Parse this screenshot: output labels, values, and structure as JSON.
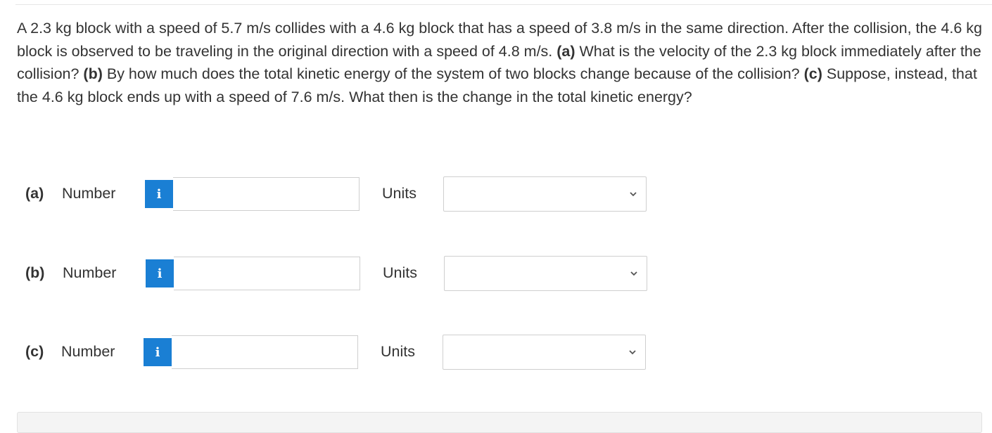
{
  "question": {
    "p1": "A 2.3 kg block with a speed of 5.7 m/s collides with a 4.6 kg block that has a speed of 3.8 m/s in the same direction. After the collision, the 4.6 kg block is observed to be traveling in the original direction with a speed of 4.8 m/s. ",
    "a_tag": "(a)",
    "p2": " What is the velocity of the 2.3 kg block immediately after the collision? ",
    "b_tag": "(b)",
    "p3": " By how much does the total kinetic energy of the system of two blocks change because of the collision? ",
    "c_tag": "(c)",
    "p4": " Suppose, instead, that the 4.6 kg block ends up with a speed of 7.6 m/s. What then is the change in the total kinetic energy?"
  },
  "parts": [
    {
      "tag": "(a)",
      "number_label": "Number",
      "info_icon": "i",
      "value": "",
      "units_label": "Units",
      "units_value": ""
    },
    {
      "tag": "(b)",
      "number_label": "Number",
      "info_icon": "i",
      "value": "",
      "units_label": "Units",
      "units_value": ""
    },
    {
      "tag": "(c)",
      "number_label": "Number",
      "info_icon": "i",
      "value": "",
      "units_label": "Units",
      "units_value": ""
    }
  ],
  "colors": {
    "info_button": "#1a7fd4",
    "text": "#333333",
    "border": "#cfcfcf"
  },
  "icons": {
    "info": "info-icon",
    "dropdown": "chevron-down-icon"
  }
}
